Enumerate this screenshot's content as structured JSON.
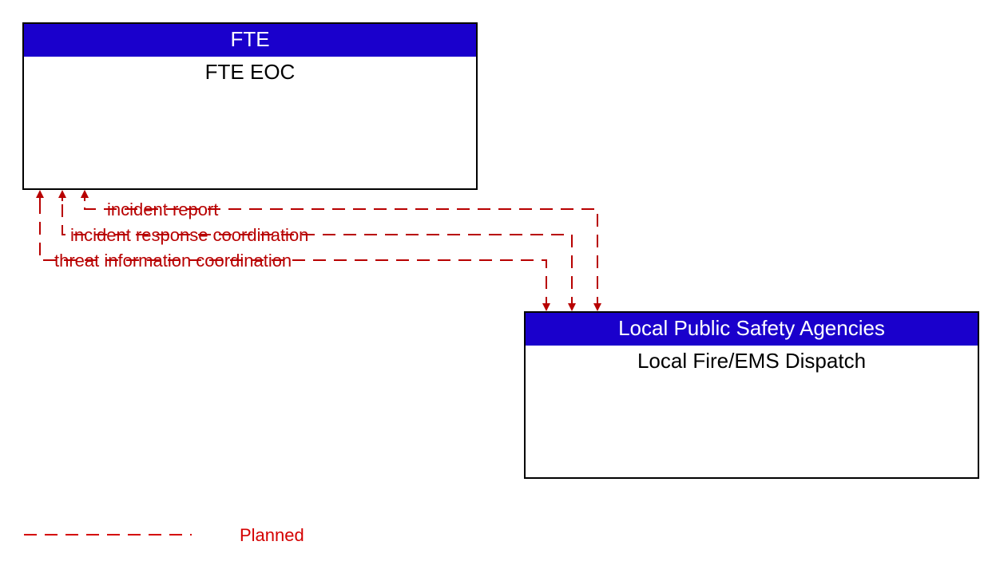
{
  "diagram": {
    "nodes": {
      "topLeft": {
        "header": "FTE",
        "body": "FTE EOC"
      },
      "bottomRight": {
        "header": "Local Public Safety Agencies",
        "body": "Local Fire/EMS Dispatch"
      }
    },
    "flows": [
      {
        "label": "incident report"
      },
      {
        "label": "incident response coordination"
      },
      {
        "label": "threat information coordination"
      }
    ],
    "legend": {
      "label": "Planned"
    },
    "colors": {
      "header_bg": "#1a00cc",
      "flow": "#b80000",
      "legend": "#d40000"
    },
    "style": {
      "line_style": "dashed"
    }
  }
}
